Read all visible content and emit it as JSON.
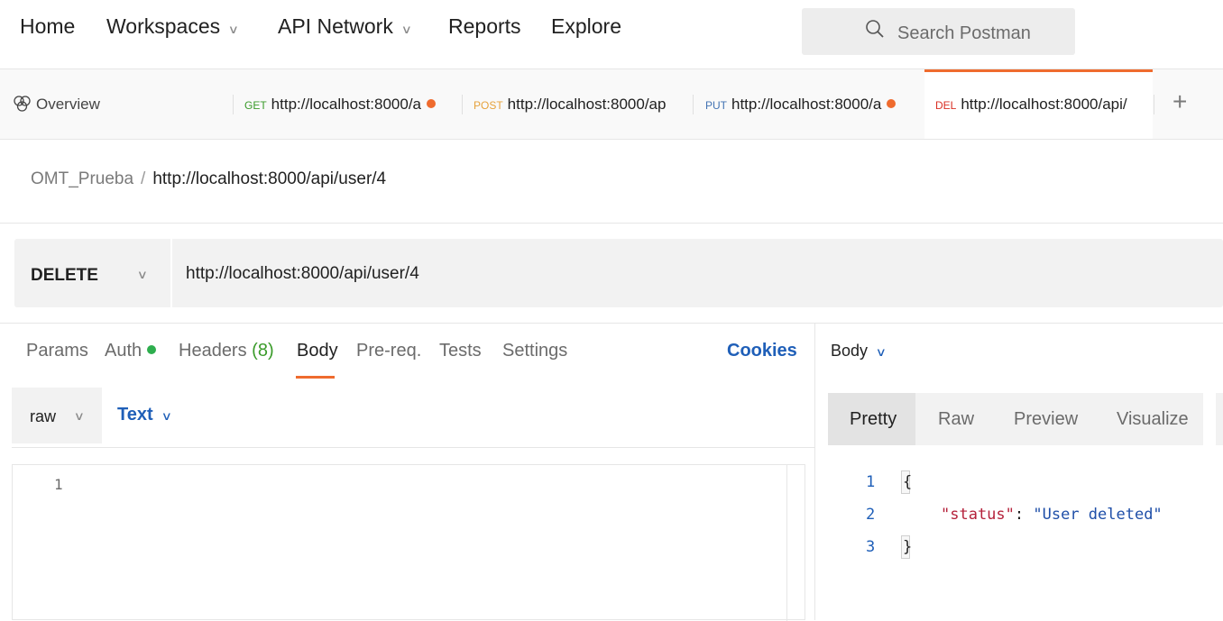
{
  "nav": {
    "home": "Home",
    "workspaces": "Workspaces",
    "api_network": "API Network",
    "reports": "Reports",
    "explore": "Explore",
    "search_placeholder": "Search Postman"
  },
  "tabs": {
    "overview": "Overview",
    "items": [
      {
        "method": "GET",
        "url": "http://localhost:8000/a",
        "unsaved": true
      },
      {
        "method": "POST",
        "url": "http://localhost:8000/ap",
        "unsaved": false
      },
      {
        "method": "PUT",
        "url": "http://localhost:8000/a",
        "unsaved": true
      },
      {
        "method": "DEL",
        "url": "http://localhost:8000/api/",
        "unsaved": false,
        "active": true
      }
    ],
    "new_tab": "+"
  },
  "breadcrumb": {
    "collection": "OMT_Prueba",
    "separator": "/",
    "request": "http://localhost:8000/api/user/4"
  },
  "request": {
    "method": "DELETE",
    "url": "http://localhost:8000/api/user/4",
    "subtabs": {
      "params": "Params",
      "auth": "Auth",
      "headers": "Headers",
      "headers_count": "(8)",
      "body": "Body",
      "prereq": "Pre-req.",
      "tests": "Tests",
      "settings": "Settings",
      "active": "Body"
    },
    "cookies": "Cookies",
    "body_mode": "raw",
    "body_format": "Text",
    "editor_lines": [
      "1"
    ]
  },
  "response": {
    "section": "Body",
    "view_tabs": [
      "Pretty",
      "Raw",
      "Preview",
      "Visualize"
    ],
    "active_view": "Pretty",
    "line_numbers": [
      "1",
      "2",
      "3"
    ],
    "json": {
      "open": "{",
      "key": "\"status\"",
      "colon": ": ",
      "value": "\"User deleted\"",
      "close": "}"
    }
  },
  "colors": {
    "accent": "#ef6b2e",
    "link": "#1f5fb8",
    "get": "#3a9b2a",
    "post": "#e6a23c",
    "put": "#4273b3",
    "delete": "#d93025"
  },
  "icons": [
    "search-icon",
    "overview-icon",
    "chevron-down-icon",
    "plus-icon",
    "status-dot"
  ]
}
